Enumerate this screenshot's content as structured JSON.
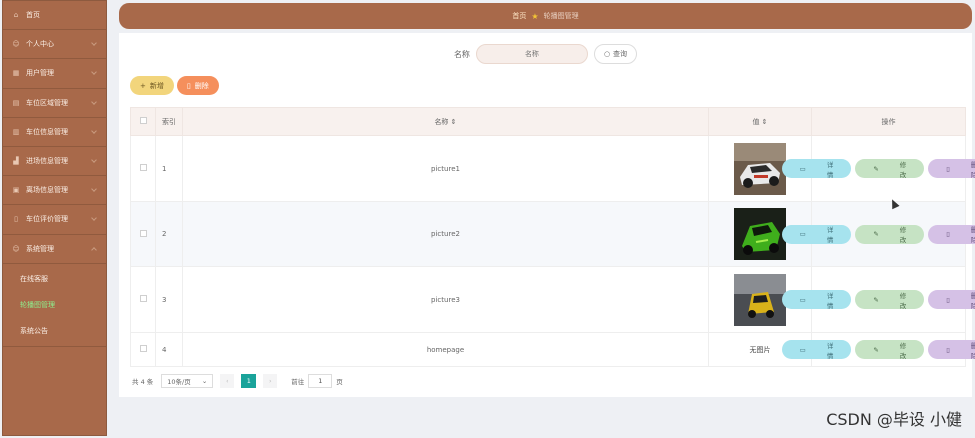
{
  "sidebar": {
    "items": [
      {
        "label": "首页",
        "icon": "home-icon"
      },
      {
        "label": "个人中心",
        "icon": "user-icon"
      },
      {
        "label": "用户管理",
        "icon": "grid-icon"
      },
      {
        "label": "车位区域管理",
        "icon": "grid-icon"
      },
      {
        "label": "车位信息管理",
        "icon": "grid-icon"
      },
      {
        "label": "进场信息管理",
        "icon": "chart-icon"
      },
      {
        "label": "离场信息管理",
        "icon": "grid-icon"
      },
      {
        "label": "车位评价管理",
        "icon": "file-icon"
      },
      {
        "label": "系统管理",
        "icon": "user-icon"
      }
    ],
    "subitems": [
      {
        "label": "在线客服"
      },
      {
        "label": "轮播图管理"
      },
      {
        "label": "系统公告"
      }
    ]
  },
  "breadcrumb": {
    "home": "首页",
    "current": "轮播图管理"
  },
  "search": {
    "label": "名称",
    "placeholder": "名称",
    "button": "查询"
  },
  "toolbar": {
    "add": "新增",
    "delete": "删除"
  },
  "table": {
    "headers": {
      "index": "索引",
      "name": "名称",
      "value": "值",
      "ops": "操作"
    },
    "rows": [
      {
        "index": "1",
        "name": "picture1",
        "image": "white sports car"
      },
      {
        "index": "2",
        "name": "picture2",
        "image": "green sports car"
      },
      {
        "index": "3",
        "name": "picture3",
        "image": "yellow sports car"
      },
      {
        "index": "4",
        "name": "homepage",
        "no_image": "无图片"
      }
    ],
    "row_actions": {
      "detail": "详情",
      "edit": "修改",
      "delete": "删除"
    }
  },
  "pagination": {
    "total": "共 4 条",
    "page_size": "10条/页",
    "current_page": "1",
    "goto_label": "前往",
    "goto_value": "1",
    "page_suffix": "页"
  },
  "watermark": "CSDN @毕设  小健",
  "colors": {
    "sidebar": "#a8694a",
    "active_sub": "#8ef08e",
    "pager_active": "#1aa39a"
  }
}
